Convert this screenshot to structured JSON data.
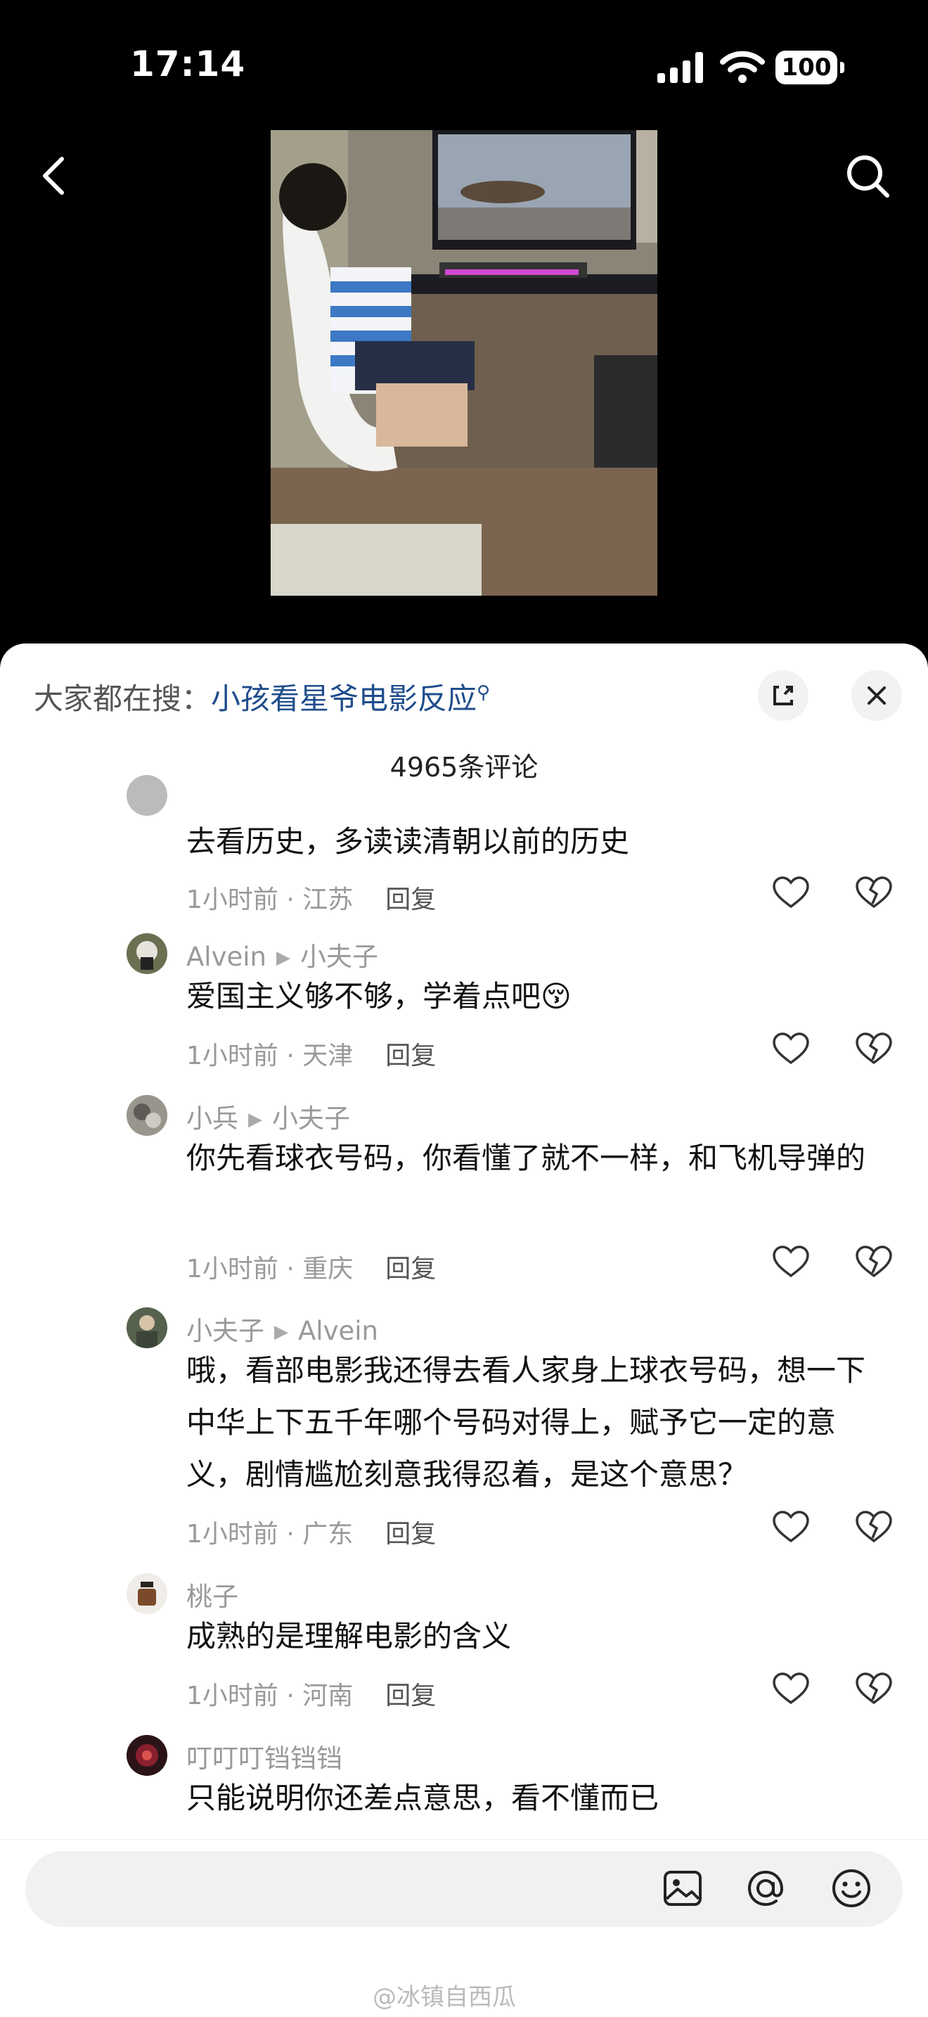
{
  "status_bar": {
    "time": "17:14",
    "battery": "100"
  },
  "search_hint": {
    "prefix": "大家都在搜：",
    "query": "小孩看星爷电影反应",
    "suffix_icon": "search-small-icon"
  },
  "comment_count": "4965条评论",
  "comments": [
    {
      "author": "",
      "reply_to": "",
      "text": "去看历史，多读读清朝以前的历史",
      "time_loc": "1小时前 · 江苏",
      "reply": "回复"
    },
    {
      "author": "Alvein",
      "reply_to": "小夫子",
      "text": "爱国主义够不够，学着点吧😚",
      "time_loc": "1小时前 · 天津",
      "reply": "回复"
    },
    {
      "author": "小兵",
      "reply_to": "小夫子",
      "text": "你先看球衣号码，你看懂了就不一样，和飞机导弹的",
      "time_loc": "1小时前 · 重庆",
      "reply": "回复"
    },
    {
      "author": "小夫子",
      "reply_to": "Alvein",
      "text": "哦，看部电影我还得去看人家身上球衣号码，想一下中华上下五千年哪个号码对得上，赋予它一定的意义，剧情尴尬刻意我得忍着，是这个意思？",
      "time_loc": "1小时前 · 广东",
      "reply": "回复"
    },
    {
      "author": "桃子",
      "reply_to": "",
      "text": "成熟的是理解电影的含义",
      "time_loc": "1小时前 · 河南",
      "reply": "回复"
    },
    {
      "author": "叮叮叮铛铛铛",
      "reply_to": "",
      "text": "只能说明你还差点意思，看不懂而已",
      "time_loc": "",
      "reply": ""
    }
  ],
  "watermark": "@冰镇自西瓜",
  "colors": {
    "link": "#1f4d8c",
    "meta": "#999999",
    "sheet": "#ffffff",
    "top": "#000000"
  }
}
